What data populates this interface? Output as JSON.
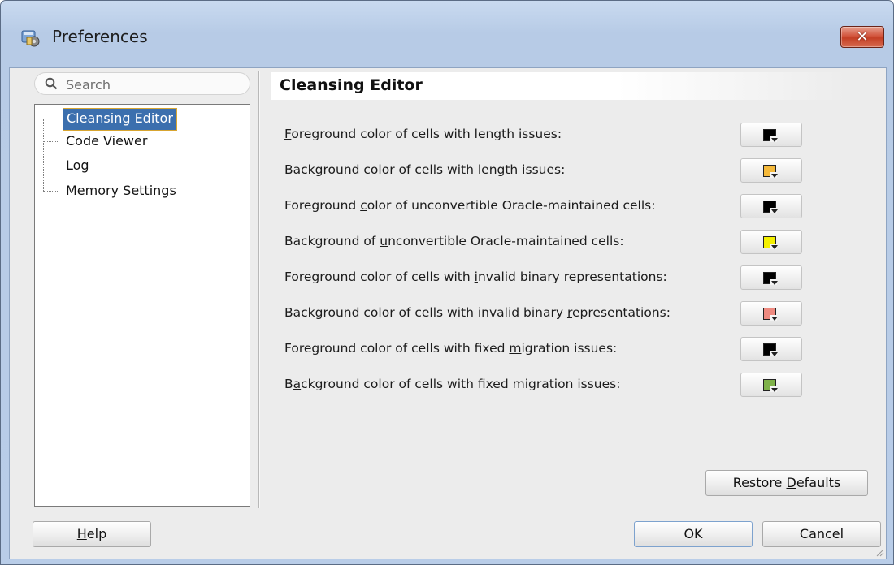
{
  "window": {
    "title": "Preferences",
    "close_glyph": "✕"
  },
  "search": {
    "placeholder": "Search",
    "value": ""
  },
  "tree": {
    "items": [
      {
        "label": "Cleansing Editor",
        "selected": true
      },
      {
        "label": "Code Viewer",
        "selected": false
      },
      {
        "label": "Log",
        "selected": false
      },
      {
        "label": "Memory Settings",
        "selected": false
      }
    ]
  },
  "page": {
    "title": "Cleansing Editor",
    "rows": [
      {
        "before": "",
        "mnemonic": "F",
        "after": "oreground color of cells with length issues:",
        "color": "#000000"
      },
      {
        "before": "",
        "mnemonic": "B",
        "after": "ackground color of cells with length issues:",
        "color": "#f5b93a"
      },
      {
        "before": "Foreground ",
        "mnemonic": "c",
        "after": "olor of unconvertible Oracle-maintained cells:",
        "color": "#000000"
      },
      {
        "before": "Background of ",
        "mnemonic": "u",
        "after": "nconvertible Oracle-maintained cells:",
        "color": "#f4f000"
      },
      {
        "before": "Foreground color of cells with ",
        "mnemonic": "i",
        "after": "nvalid binary representations:",
        "color": "#000000"
      },
      {
        "before": "Background color of cells with invalid binary ",
        "mnemonic": "r",
        "after": "epresentations:",
        "color": "#ee8a80"
      },
      {
        "before": "Foreground color of cells with fixed ",
        "mnemonic": "m",
        "after": "igration issues:",
        "color": "#000000"
      },
      {
        "before": "B",
        "mnemonic": "a",
        "after": "ckground color of cells with fixed migration issues:",
        "color": "#7fb24a"
      }
    ]
  },
  "buttons": {
    "restore_before": "Restore ",
    "restore_mnemonic": "D",
    "restore_after": "efaults",
    "help_mnemonic": "H",
    "help_after": "elp",
    "ok": "OK",
    "cancel": "Cancel"
  },
  "icons": {
    "app": "preferences-app-icon",
    "search": "search-icon",
    "close": "close-icon",
    "resize": "resize-grip-icon"
  },
  "colors": {
    "selection": "#3b6fae",
    "selection_border": "#d8a530",
    "close_red": "#c43f25"
  }
}
